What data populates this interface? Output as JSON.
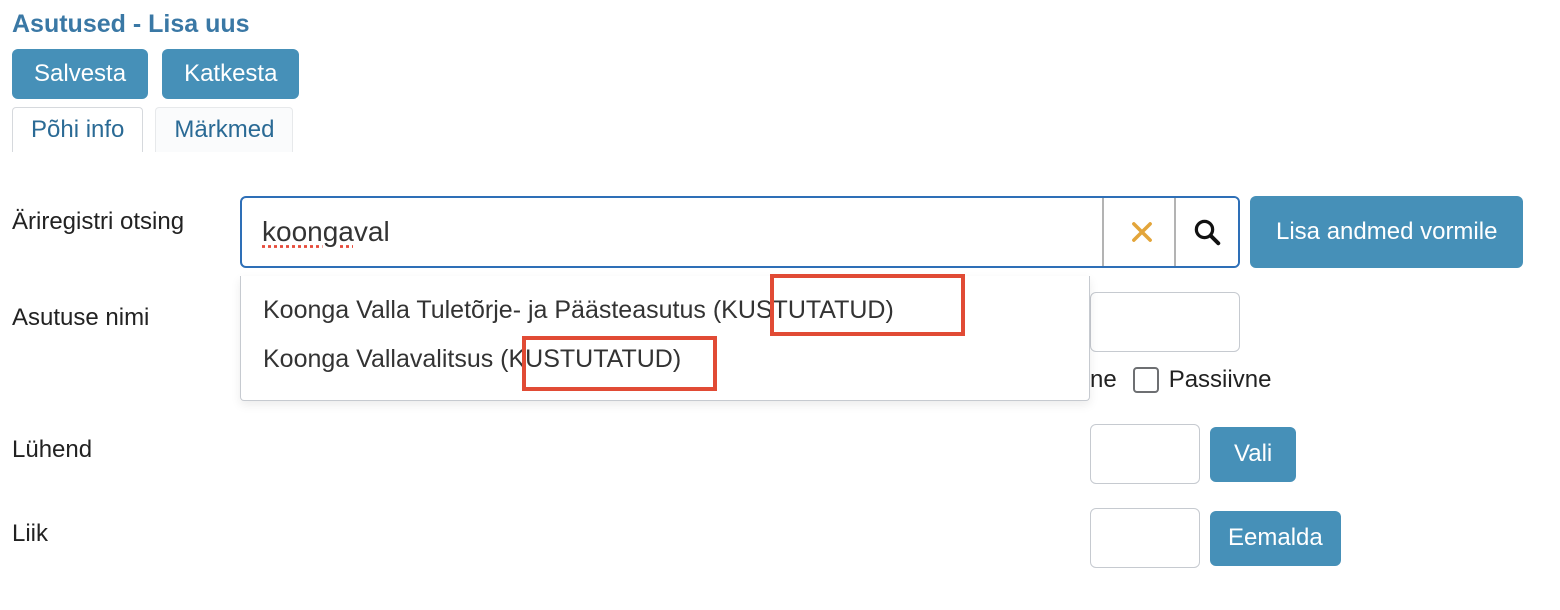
{
  "page_title": "Asutused - Lisa uus",
  "actions": {
    "save_label": "Salvesta",
    "cancel_label": "Katkesta"
  },
  "tabs": {
    "main_label": "Põhi info",
    "notes_label": "Märkmed",
    "active_index": 0
  },
  "search": {
    "label": "Äriregistri otsing",
    "value_word1": "koonga",
    "value_word2": " val",
    "clear_icon": "clear-icon",
    "search_icon": "search-icon",
    "add_button_label": "Lisa andmed vormile",
    "dropdown": [
      "Koonga Valla Tuletõrje- ja Päästeasutus (KUSTUTATUD)",
      "Koonga Vallavalitsus (KUSTUTATUD)"
    ]
  },
  "fields": {
    "name_label": "Asutuse nimi",
    "name_value": "",
    "status_partial_label_visible": "ne",
    "passive_label": "Passiivne",
    "abbrev_label": "Lühend",
    "abbrev_value": "",
    "vali_button_label": "Vali",
    "type_label": "Liik",
    "type_value": "",
    "eemalda_button_label": "Eemalda"
  },
  "colors": {
    "primary": "#4690b8",
    "link": "#2a6a95",
    "highlight": "#e14b35"
  }
}
